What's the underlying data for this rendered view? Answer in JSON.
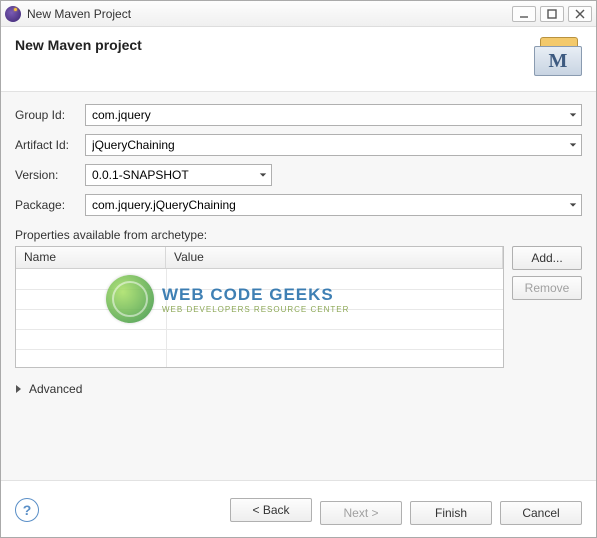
{
  "window": {
    "title": "New Maven Project"
  },
  "header": {
    "heading": "New Maven project",
    "maven_letter": "M"
  },
  "form": {
    "groupId": {
      "label": "Group Id:",
      "value": "com.jquery"
    },
    "artifactId": {
      "label": "Artifact Id:",
      "value": "jQueryChaining"
    },
    "version": {
      "label": "Version:",
      "value": "0.0.1-SNAPSHOT"
    },
    "package": {
      "label": "Package:",
      "value": "com.jquery.jQueryChaining"
    }
  },
  "properties": {
    "label": "Properties available from archetype:",
    "columns": {
      "name": "Name",
      "value": "Value"
    },
    "buttons": {
      "add": "Add...",
      "remove": "Remove"
    }
  },
  "watermark": {
    "line1a": "WEB",
    "line1b": "CODE GEEKS",
    "line2": "WEB DEVELOPERS RESOURCE CENTER"
  },
  "advanced": {
    "label": "Advanced"
  },
  "footer": {
    "back": "< Back",
    "next": "Next >",
    "finish": "Finish",
    "cancel": "Cancel",
    "help": "?"
  }
}
